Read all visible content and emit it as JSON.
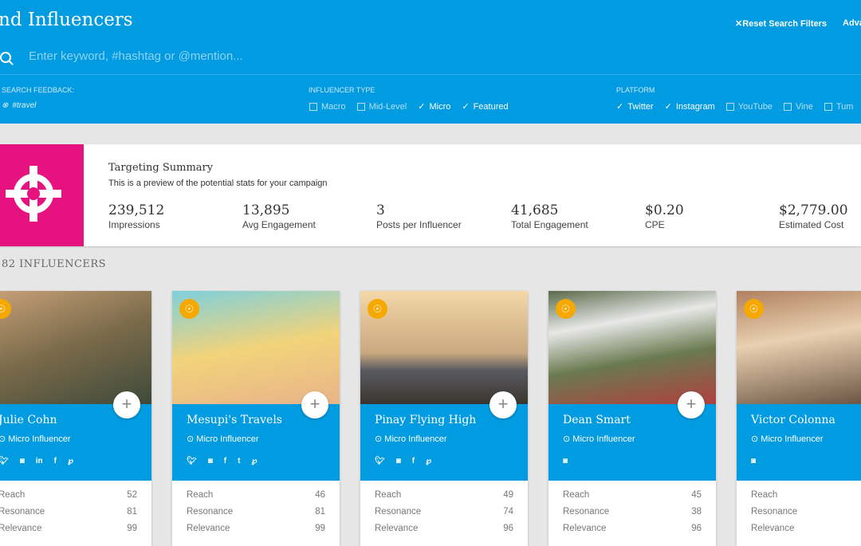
{
  "header": {
    "title": "nd Influencers",
    "reset_label": "Reset Search Filters",
    "advanced_label": "Adva",
    "search_placeholder": "Enter keyword, #hashtag or @mention..."
  },
  "filters": {
    "feedback": {
      "label": "SEARCH FEEDBACK:",
      "tags": [
        "#travel"
      ]
    },
    "influencer_type": {
      "label": "INFLUENCER TYPE",
      "options": [
        {
          "label": "Macro",
          "checked": false
        },
        {
          "label": "Mid-Level",
          "checked": false
        },
        {
          "label": "Micro",
          "checked": true
        },
        {
          "label": "Featured",
          "checked": true
        }
      ]
    },
    "platform": {
      "label": "PLATFORM",
      "options": [
        {
          "label": "Twitter",
          "checked": true
        },
        {
          "label": "Instagram",
          "checked": true
        },
        {
          "label": "YouTube",
          "checked": false
        },
        {
          "label": "Vine",
          "checked": false
        },
        {
          "label": "Tum",
          "checked": false
        }
      ]
    }
  },
  "summary": {
    "title": "Targeting Summary",
    "subtitle": "This is a preview of the potential stats for your campaign",
    "accent": "#e6127f",
    "stats": [
      {
        "value": "239,512",
        "label": "Impressions"
      },
      {
        "value": "13,895",
        "label": "Avg Engagement"
      },
      {
        "value": "3",
        "label": "Posts per Influencer"
      },
      {
        "value": "41,685",
        "label": "Total Engagement"
      },
      {
        "value": "$0.20",
        "label": "CPE"
      },
      {
        "value": "$2,779.00",
        "label": "Estimated Cost"
      }
    ]
  },
  "results_count": "82 INFLUENCERS",
  "cards": [
    {
      "name": "Julie Cohn",
      "type": "Micro Influencer",
      "socials": [
        "twitter",
        "instagram",
        "linkedin",
        "facebook",
        "pinterest"
      ],
      "metrics": [
        {
          "label": "Reach",
          "value": "52"
        },
        {
          "label": "Resonance",
          "value": "81"
        },
        {
          "label": "Relevance",
          "value": "99"
        }
      ]
    },
    {
      "name": "Mesupi's Travels",
      "type": "Micro Influencer",
      "socials": [
        "twitter",
        "instagram",
        "facebook",
        "tumblr",
        "pinterest"
      ],
      "metrics": [
        {
          "label": "Reach",
          "value": "46"
        },
        {
          "label": "Resonance",
          "value": "81"
        },
        {
          "label": "Relevance",
          "value": "99"
        }
      ]
    },
    {
      "name": "Pinay Flying High",
      "type": "Micro Influencer",
      "socials": [
        "twitter",
        "instagram",
        "facebook",
        "pinterest"
      ],
      "metrics": [
        {
          "label": "Reach",
          "value": "49"
        },
        {
          "label": "Resonance",
          "value": "74"
        },
        {
          "label": "Relevance",
          "value": "96"
        }
      ]
    },
    {
      "name": "Dean Smart",
      "type": "Micro Influencer",
      "socials": [
        "instagram"
      ],
      "metrics": [
        {
          "label": "Reach",
          "value": "45"
        },
        {
          "label": "Resonance",
          "value": "38"
        },
        {
          "label": "Relevance",
          "value": "96"
        }
      ]
    },
    {
      "name": "Victor Colonna",
      "type": "Micro Influencer",
      "socials": [
        "instagram"
      ],
      "metrics": [
        {
          "label": "Reach",
          "value": ""
        },
        {
          "label": "Resonance",
          "value": ""
        },
        {
          "label": "Relevance",
          "value": ""
        }
      ]
    }
  ]
}
